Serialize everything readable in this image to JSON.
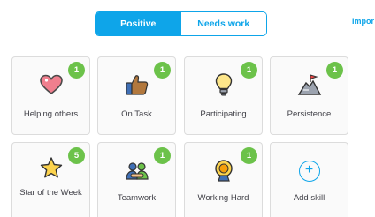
{
  "toggle": {
    "positive_label": "Positive",
    "needs_work_label": "Needs work",
    "accent": "#0ea5e9"
  },
  "import_link": "Impor",
  "badge_color": "#6cc24a",
  "skills": [
    {
      "label": "Helping others",
      "count": "1",
      "icon": "heart-icon"
    },
    {
      "label": "On Task",
      "count": "1",
      "icon": "thumbs-up-icon"
    },
    {
      "label": "Participating",
      "count": "1",
      "icon": "lightbulb-icon"
    },
    {
      "label": "Persistence",
      "count": "1",
      "icon": "mountain-flag-icon"
    },
    {
      "label": "Star of the Week",
      "count": "5",
      "icon": "star-icon"
    },
    {
      "label": "Teamwork",
      "count": "1",
      "icon": "teamwork-icon"
    },
    {
      "label": "Working Hard",
      "count": "1",
      "icon": "medal-icon"
    }
  ],
  "add_skill": {
    "label": "Add skill",
    "icon_glyph": "+"
  }
}
